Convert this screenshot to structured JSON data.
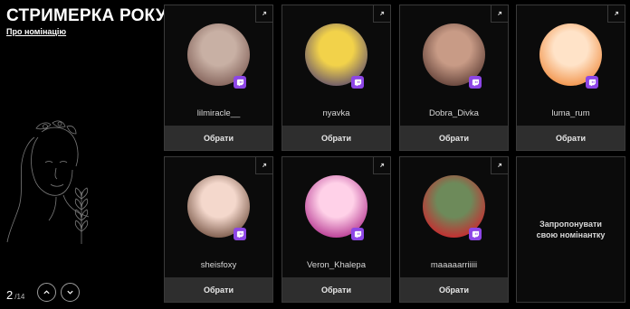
{
  "page": {
    "title": "СТРИМЕРКА РОКУ",
    "about_link": "Про номінацію"
  },
  "pager": {
    "current": "2",
    "total": "/14"
  },
  "cards": [
    {
      "name": "lilmiracle__",
      "button": "Обрати",
      "avatar_colors": [
        "#c8b0a4",
        "#7c5a52"
      ]
    },
    {
      "name": "nyavka",
      "button": "Обрати",
      "avatar_colors": [
        "#f2d24a",
        "#5b4a6e"
      ]
    },
    {
      "name": "Dobra_Divka",
      "button": "Обрати",
      "avatar_colors": [
        "#c89b86",
        "#5a3a32"
      ]
    },
    {
      "name": "luma_rum",
      "button": "Обрати",
      "avatar_colors": [
        "#ffe3c8",
        "#f08a3c"
      ]
    },
    {
      "name": "sheisfoxy",
      "button": "Обрати",
      "avatar_colors": [
        "#f4d8cc",
        "#6e4c3c"
      ]
    },
    {
      "name": "Veron_Khalepa",
      "button": "Обрати",
      "avatar_colors": [
        "#ffd1e8",
        "#b02a8a"
      ]
    },
    {
      "name": "maaaaarriiiii",
      "button": "Обрати",
      "avatar_colors": [
        "#6d8a5a",
        "#d41f2a"
      ]
    }
  ],
  "suggest": {
    "line1": "Запропонувати",
    "line2": "свою номінантку"
  },
  "colors": {
    "accent": "#8d46e6",
    "button_bg": "#2e2e2e",
    "border": "#3a3a3a"
  },
  "icons": {
    "platform": "twitch-icon",
    "external": "external-link-icon",
    "prev": "chevron-up-icon",
    "next": "chevron-down-icon"
  }
}
